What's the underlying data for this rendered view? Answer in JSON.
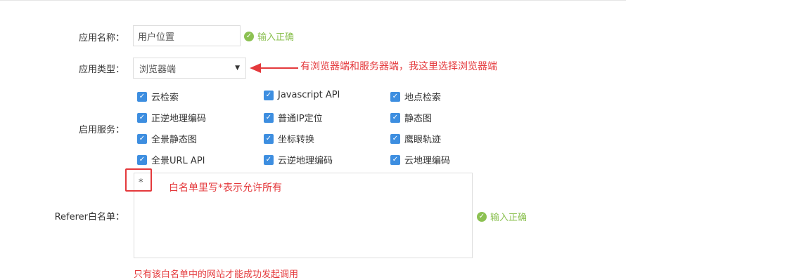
{
  "form": {
    "app_name": {
      "label": "应用名称：",
      "value": "用户位置",
      "status": "输入正确"
    },
    "app_type": {
      "label": "应用类型：",
      "value": "浏览器端",
      "annotation": "有浏览器端和服务器端，我这里选择浏览器端"
    },
    "services": {
      "label": "启用服务：",
      "items": [
        {
          "label": "云检索",
          "checked": true
        },
        {
          "label": "Javascript API",
          "checked": true
        },
        {
          "label": "地点检索",
          "checked": true
        },
        {
          "label": "正逆地理编码",
          "checked": true
        },
        {
          "label": "普通IP定位",
          "checked": true
        },
        {
          "label": "静态图",
          "checked": true
        },
        {
          "label": "全景静态图",
          "checked": true
        },
        {
          "label": "坐标转换",
          "checked": true
        },
        {
          "label": "鹰眼轨迹",
          "checked": true
        },
        {
          "label": "全景URL API",
          "checked": true
        },
        {
          "label": "云逆地理编码",
          "checked": true
        },
        {
          "label": "云地理编码",
          "checked": true
        }
      ]
    },
    "referer": {
      "label": "Referer白名单：",
      "value": "*",
      "annotation": "白名单里写*表示允许所有",
      "status": "输入正确",
      "hint": "只有该白名单中的网站才能成功发起调用"
    }
  },
  "colors": {
    "success": "#8cc152",
    "annotation_red": "#e4393c",
    "checkbox_blue": "#3d8ee0"
  },
  "icons": {
    "success": "check-circle-icon",
    "checkbox": "checkbox-checked-icon",
    "caret": "caret-down-icon",
    "arrow": "arrow-left-icon"
  }
}
